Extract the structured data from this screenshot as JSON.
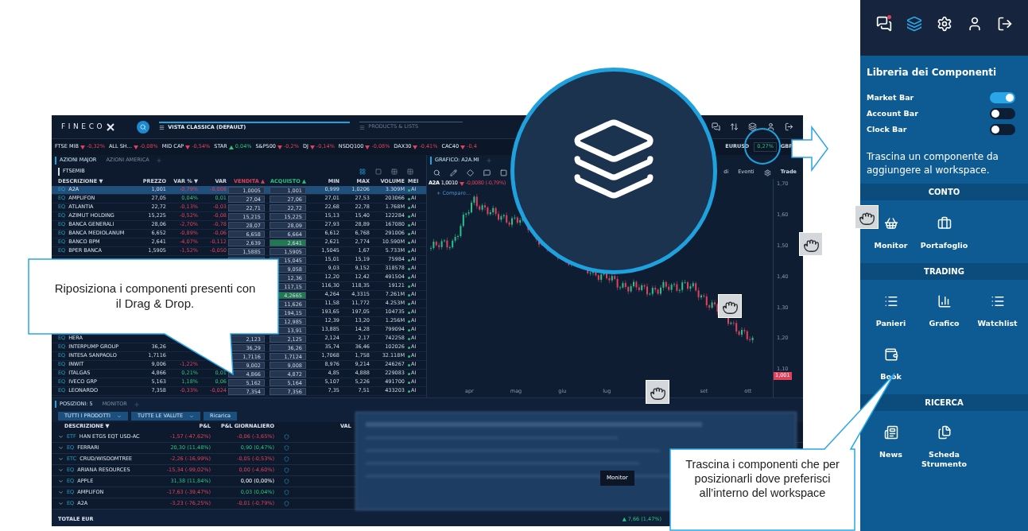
{
  "app": {
    "logo": "FINECO",
    "view_tab": "VISTA CLASSICA (DEFAULT)",
    "products_tab": "PRODUCTS & LISTS",
    "ticker": [
      {
        "kind": "index",
        "label": "FTSE MIB",
        "change": "-0,32%",
        "down": true
      },
      {
        "kind": "index",
        "label": "ALL SH...",
        "change": "-0,08%",
        "down": true
      },
      {
        "kind": "index",
        "label": "MID CAP",
        "change": "-0,54%",
        "down": true
      },
      {
        "kind": "index",
        "label": "STAR",
        "change": "0,04%",
        "down": false
      },
      {
        "kind": "index",
        "label": "S&P500",
        "change": "-0,2%",
        "down": true
      },
      {
        "kind": "index",
        "label": "DJ",
        "change": "-0,14%",
        "down": true
      },
      {
        "kind": "index",
        "label": "NSDQ100",
        "change": "-0,08%",
        "down": true
      },
      {
        "kind": "index",
        "label": "DAX30",
        "change": "-0,41%",
        "down": true
      },
      {
        "kind": "index",
        "label": "CAC40",
        "change": "-0,4",
        "down": true
      },
      {
        "kind": "currency",
        "label": "EURUSD",
        "change": "0,27%"
      },
      {
        "kind": "currency",
        "label": "GBP"
      }
    ],
    "watchlist": {
      "tabs": [
        {
          "label": "AZIONI MAJOR",
          "selected": true
        },
        {
          "label": "AZIONI AMERICA",
          "selected": false
        }
      ],
      "title": "FTSEMIB",
      "columns": [
        "DESCRIZIONE ▼",
        "PREZZO",
        "VAR % ▼",
        "VAR",
        "VENDITA ▲",
        "ACQUISTO ▲",
        "MIN",
        "MAX",
        "VOLUME",
        "MEI"
      ],
      "rows": [
        {
          "type": "EQ",
          "name": "A2A",
          "price": "1,001",
          "var_pct": "-0,79%",
          "var": "-0,008",
          "down": true,
          "sell": "1,0005",
          "buy": "1,001",
          "buy_flash": false,
          "min": "0,999",
          "max": "1,0206",
          "volume": "3.309M",
          "market": "AI",
          "selected": true
        },
        {
          "type": "EQ",
          "name": "AMPLIFON",
          "price": "27,05",
          "var_pct": "0,04%",
          "var": "0,01",
          "down": false,
          "sell": "27,04",
          "buy": "27,06",
          "buy_flash": false,
          "min": "27,01",
          "max": "27,53",
          "volume": "203066",
          "market": "AI",
          "selected": false
        },
        {
          "type": "EQ",
          "name": "ATLANTIA",
          "price": "22,72",
          "var_pct": "-0,13%",
          "var": "-0,03",
          "down": true,
          "sell": "22,71",
          "buy": "22,72",
          "buy_flash": false,
          "min": "22,68",
          "max": "22,78",
          "volume": "1.768M",
          "market": "AI",
          "selected": false
        },
        {
          "type": "EQ",
          "name": "AZIMUT HOLDING",
          "price": "15,225",
          "var_pct": "-0,52%",
          "var": "-0,08",
          "down": true,
          "sell": "15,215",
          "buy": "15,225",
          "buy_flash": false,
          "min": "15,13",
          "max": "15,40",
          "volume": "122284",
          "market": "AI",
          "selected": false
        },
        {
          "type": "EQ",
          "name": "BANCA GENERALI",
          "price": "28,06",
          "var_pct": "-2,70%",
          "var": "-0,78",
          "down": true,
          "sell": "28,07",
          "buy": "28,09",
          "buy_flash": false,
          "min": "27,93",
          "max": "28,89",
          "volume": "167080",
          "market": "AI",
          "selected": false
        },
        {
          "type": "EQ",
          "name": "BANCA MEDIOLANUM",
          "price": "6,652",
          "var_pct": "-0,89%",
          "var": "-0,06",
          "down": true,
          "sell": "6,658",
          "buy": "6,664",
          "buy_flash": false,
          "min": "6,612",
          "max": "6,768",
          "volume": "291006",
          "market": "AI",
          "selected": false
        },
        {
          "type": "EQ",
          "name": "BANCO BPM",
          "price": "2,641",
          "var_pct": "-4,07%",
          "var": "-0,112",
          "down": true,
          "sell": "2,639",
          "buy": "2,641",
          "buy_flash": true,
          "min": "2,621",
          "max": "2,774",
          "volume": "10.590M",
          "market": "AI",
          "selected": false
        },
        {
          "type": "EQ",
          "name": "BPER BANCA",
          "price": "1,5905",
          "var_pct": "-1,52%",
          "var": "-0,050",
          "down": true,
          "sell": "1,5885",
          "buy": "1,5905",
          "buy_flash": false,
          "min": "1,5045",
          "max": "1,67",
          "volume": "5.733M",
          "market": "AI",
          "selected": false
        },
        {
          "buy": "15,045",
          "buy_flash": false,
          "min": "15,01",
          "max": "15,19",
          "volume": "75984",
          "market": "AI",
          "selected": false
        },
        {
          "buy": "9,058",
          "buy_flash": false,
          "min": "9,03",
          "max": "9,152",
          "volume": "318578",
          "market": "AI",
          "selected": false
        },
        {
          "buy": "12,36",
          "buy_flash": false,
          "min": "12,20",
          "max": "12,42",
          "volume": "491504",
          "market": "AI",
          "selected": false
        },
        {
          "buy": "117,15",
          "buy_flash": false,
          "min": "116,30",
          "max": "118,35",
          "volume": "19121",
          "market": "AI",
          "selected": false
        },
        {
          "buy": "4,2665",
          "buy_flash": true,
          "min": "4,264",
          "max": "4,3315",
          "volume": "7.261M",
          "market": "AI",
          "selected": false
        },
        {
          "buy": "11,626",
          "buy_flash": false,
          "min": "11,58",
          "max": "11,772",
          "volume": "4.253M",
          "market": "AI",
          "selected": false
        },
        {
          "buy": "194,15",
          "buy_flash": false,
          "min": "193,65",
          "max": "197,05",
          "volume": "104735",
          "market": "AI",
          "selected": false
        },
        {
          "buy": "12,985",
          "buy_flash": false,
          "min": "12,39",
          "max": "13,20",
          "volume": "1.256M",
          "market": "AI",
          "selected": false
        },
        {
          "buy": "13,91",
          "buy_flash": false,
          "min": "13,885",
          "max": "14,28",
          "volume": "799094",
          "market": "AI",
          "selected": false
        },
        {
          "type": "EQ",
          "name": "HERA",
          "sell": "2,123",
          "buy": "2,125",
          "buy_flash": false,
          "min": "2,124",
          "max": "2,17",
          "volume": "742258",
          "market": "AI",
          "selected": false
        },
        {
          "type": "EQ",
          "name": "INTERPUMP GROUP",
          "price": "36,26",
          "sell": "36,29",
          "buy": "36,26",
          "buy_flash": false,
          "min": "35,74",
          "max": "36,46",
          "volume": "102026",
          "market": "AI",
          "selected": false
        },
        {
          "type": "EQ",
          "name": "INTESA SANPAOLO",
          "price": "1,7116",
          "sell": "1,7116",
          "buy": "1,7124",
          "buy_flash": false,
          "min": "1,7068",
          "max": "1,758",
          "volume": "32.118M",
          "market": "AI",
          "selected": false
        },
        {
          "type": "EQ",
          "name": "INWIT",
          "price": "9,006",
          "var_pct": "-1,22%",
          "down": true,
          "sell": "9,002",
          "buy": "9,008",
          "buy_flash": false,
          "min": "8,976",
          "max": "9,214",
          "volume": "246267",
          "market": "AI",
          "selected": false
        },
        {
          "type": "EQ",
          "name": "ITALGAS",
          "price": "4,866",
          "var_pct": "0,21%",
          "var": "0,01",
          "down": false,
          "sell": "4,866",
          "buy": "4,872",
          "buy_flash": false,
          "min": "4,85",
          "max": "4,888",
          "volume": "229083",
          "market": "AI",
          "selected": false
        },
        {
          "type": "EQ",
          "name": "IVECO GRP",
          "price": "5,163",
          "var_pct": "1,18%",
          "var": "0,06",
          "down": false,
          "sell": "5,162",
          "buy": "5,164",
          "buy_flash": false,
          "min": "5,107",
          "max": "5,226",
          "volume": "491700",
          "market": "AI",
          "selected": false
        },
        {
          "type": "EQ",
          "name": "LEONARDO",
          "price": "7,358",
          "var_pct": "-0,33%",
          "var": "-0,024",
          "down": true,
          "sell": "7,354",
          "buy": "7,356",
          "buy_flash": false,
          "min": "7,35",
          "max": "7,51",
          "volume": "433203",
          "market": "AI",
          "selected": false
        }
      ]
    },
    "chart": {
      "tab": "GRAFICO: A2A.MI",
      "symbol": "A2A",
      "price": "1,0010",
      "change": "-0,0080 (-0,79%)",
      "down": true,
      "compare": "+ Compare...",
      "tools": [
        "di",
        "Eventi",
        "Trade"
      ],
      "y_labels": [
        "1,70",
        "1,60",
        "1,50",
        "1,40",
        "1,30",
        "1,20",
        "1,10"
      ],
      "last_price": "1,001",
      "x_labels": [
        "apr",
        "mag",
        "giu",
        "lug",
        "set",
        "ott"
      ]
    },
    "positions": {
      "tabs": [
        {
          "label": "POSIZIONI: 5",
          "selected": true
        },
        {
          "label": "MONITOR",
          "selected": false
        }
      ],
      "filters": [
        "TUTTI I PRODOTTI",
        "TUTTE LE VALUTE"
      ],
      "reload": "Ricarica",
      "columns": [
        "DESCRIZIONE ▼",
        "P&L",
        "P&L GIORNALIERO",
        "VAL"
      ],
      "rows": [
        {
          "type": "ETF",
          "name": "HAN ETGS EQT USD-AC",
          "pl": "-1,57 (-47,62%)",
          "pl_down": true,
          "daily": "-0,06 (-3,65%)",
          "daily_up": false,
          "daily_down": true
        },
        {
          "type": "EQ",
          "name": "FERRARI",
          "pl": "20,30 (11,48%)",
          "pl_down": false,
          "daily": "0,90 (0,47%)",
          "daily_up": true,
          "daily_down": false
        },
        {
          "type": "ETC",
          "name": "CRUD/WISDOMTREE",
          "pl": "-2,26 (-16,99%)",
          "pl_down": true,
          "daily": "-0,05 (-0,53%)",
          "daily_up": false,
          "daily_down": true
        },
        {
          "type": "EQ",
          "name": "ARIANA RESOURCES",
          "pl": "-15,34 (-99,02%)",
          "pl_down": true,
          "daily": "0,00 (-4,60%)",
          "daily_up": false,
          "daily_down": true
        },
        {
          "type": "EQ",
          "name": "APPLE",
          "pl": "31,38 (11,84%)",
          "pl_down": false,
          "daily": "0,00 (0,00%)",
          "daily_up": false,
          "daily_down": false
        },
        {
          "type": "EQ",
          "name": "AMPLIFON",
          "pl": "-17,63 (-39,47%)",
          "pl_down": true,
          "daily": "0,03 (0,04%)",
          "daily_up": true,
          "daily_down": false
        },
        {
          "type": "EQ",
          "name": "A2A",
          "pl": "-3,23 (-76,25%)",
          "pl_down": true,
          "daily": "-0,01 (-0,79%)",
          "daily_up": false,
          "daily_down": true
        }
      ],
      "total_label": "TOTALE EUR",
      "total_value": "▲ 7,66 (1,47%)"
    },
    "monitor_tooltip": "Monitor"
  },
  "callouts": [
    "Riposiziona i componenti presenti con il Drag & Drop.",
    "Trascina i componenti che per posizionarli dove preferisci all’interno del workspace"
  ],
  "panel": {
    "header_icons": [
      {
        "kind": "chat",
        "notification": true,
        "selected": false
      },
      {
        "kind": "layers",
        "notification": false,
        "selected": true
      },
      {
        "kind": "settings",
        "notification": false,
        "selected": false
      },
      {
        "kind": "user",
        "notification": false,
        "selected": false
      },
      {
        "kind": "logout",
        "notification": false,
        "selected": false
      }
    ],
    "title": "Libreria dei Componenti",
    "toggles": [
      {
        "label": "Market Bar",
        "on": true
      },
      {
        "label": "Account Bar",
        "on": false
      },
      {
        "label": "Clock Bar",
        "on": false
      }
    ],
    "hint": "Trascina un componente da aggiungere al workspace.",
    "sections": [
      {
        "title": "CONTO",
        "items": [
          {
            "label": "Monitor",
            "kind": "basket"
          },
          {
            "label": "Portafoglio",
            "kind": "briefcase"
          }
        ]
      },
      {
        "title": "TRADING",
        "items": [
          {
            "label": "Panieri",
            "kind": "list"
          },
          {
            "label": "Grafico",
            "kind": "chart"
          },
          {
            "label": "Watchlist",
            "kind": "list"
          },
          {
            "label": "Book",
            "kind": "book"
          }
        ]
      },
      {
        "title": "RICERCA",
        "items": [
          {
            "label": "News",
            "kind": "news"
          },
          {
            "label": "Scheda Strumento",
            "kind": "document"
          }
        ]
      }
    ]
  }
}
